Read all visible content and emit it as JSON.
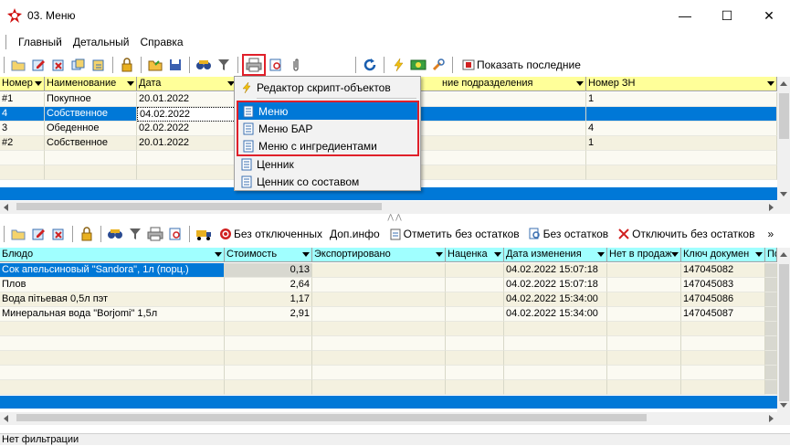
{
  "window": {
    "title": "03. Меню",
    "minimize": "—",
    "maximize": "☐",
    "close": "✕"
  },
  "menubar": [
    "Главный",
    "Детальный",
    "Справка"
  ],
  "toolbar1": {
    "show_recent": "Показать последние"
  },
  "popup": {
    "items": [
      "Редактор скрипт-объектов",
      "Меню",
      "Меню БАР",
      "Меню с ингредиентами",
      "Ценник",
      "Ценник со составом"
    ],
    "highlighted": "Меню"
  },
  "grid1": {
    "columns": [
      "Номер",
      "Наименование",
      "Дата",
      "ние подразделения",
      "Номер ЗН"
    ],
    "rows": [
      {
        "num": "#1",
        "name": "Покупное",
        "date": "20.01.2022",
        "dept": "",
        "zn": "1"
      },
      {
        "num": "4",
        "name": "Собственное",
        "date": "04.02.2022",
        "dept": "",
        "zn": ""
      },
      {
        "num": "3",
        "name": "Обеденное",
        "date": "02.02.2022",
        "dept": "",
        "zn": "4"
      },
      {
        "num": "#2",
        "name": "Собственное",
        "date": "20.01.2022",
        "dept": "",
        "zn": "1"
      }
    ]
  },
  "toolbar2": {
    "no_disabled": "Без отключенных",
    "extra_info": "Доп.инфо",
    "mark_no_stock": "Отметить без остатков",
    "no_stock": "Без остатков",
    "disable_no_stock": "Отключить без остатков",
    "more": "»"
  },
  "grid2": {
    "columns": [
      "Блюдо",
      "Стоимость",
      "Экспортировано",
      "Наценка",
      "Дата изменения",
      "Нет в продаж",
      "Ключ докумен",
      "По"
    ],
    "rows": [
      {
        "dish": "Сок апельсиновый \"Sandora\", 1л (порц.)",
        "cost": "0,13",
        "exported": "",
        "markup": "",
        "changed": "04.02.2022 15:07:18",
        "nosale": "",
        "key": "147045082"
      },
      {
        "dish": "Плов",
        "cost": "2,64",
        "exported": "",
        "markup": "",
        "changed": "04.02.2022 15:07:18",
        "nosale": "",
        "key": "147045083"
      },
      {
        "dish": "Вода пітьевая 0,5л пэт",
        "cost": "1,17",
        "exported": "",
        "markup": "",
        "changed": "04.02.2022 15:34:00",
        "nosale": "",
        "key": "147045086"
      },
      {
        "dish": "Минеральная вода \"Borjomi\" 1,5л",
        "cost": "2,91",
        "exported": "",
        "markup": "",
        "changed": "04.02.2022 15:34:00",
        "nosale": "",
        "key": "147045087"
      }
    ]
  },
  "status": "Нет фильтрации",
  "colors": {
    "header_yellow": "#ffff99",
    "header_cyan": "#a0ffff",
    "selection": "#0078d7",
    "highlight_box": "#e0202a"
  }
}
